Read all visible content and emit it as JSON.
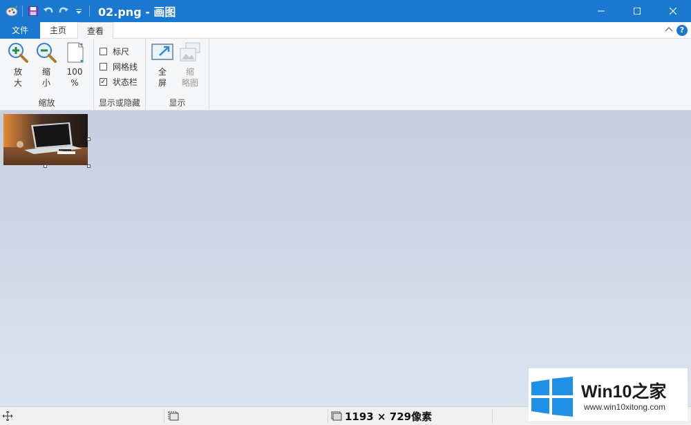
{
  "window": {
    "title": "02.png - 画图"
  },
  "tabs": {
    "file": "文件",
    "home": "主页",
    "view": "查看"
  },
  "help": {
    "label": "?"
  },
  "ribbon": {
    "zoom": {
      "group_label": "缩放",
      "zoom_in": [
        "放",
        "大"
      ],
      "zoom_out": [
        "缩",
        "小"
      ],
      "hundred": [
        "100",
        "%"
      ]
    },
    "show_hide": {
      "group_label": "显示或隐藏",
      "ruler": {
        "label": "标尺",
        "checked": false
      },
      "gridlines": {
        "label": "网格线",
        "checked": false
      },
      "statusbar": {
        "label": "状态栏",
        "checked": true,
        "mark": "✓"
      }
    },
    "display": {
      "group_label": "显示",
      "fullscreen": [
        "全",
        "屏"
      ],
      "thumbnail": [
        "缩",
        "略图"
      ]
    }
  },
  "status": {
    "image_size": "1193 × 729像素"
  },
  "watermark": {
    "title": "Win10之家",
    "url": "www.win10xitong.com"
  },
  "colors": {
    "accent": "#1a78d1",
    "ribbon_bg": "#f5f6f7",
    "canvas_top": "#c5cfdf",
    "canvas_bottom": "#dbe3ef"
  }
}
